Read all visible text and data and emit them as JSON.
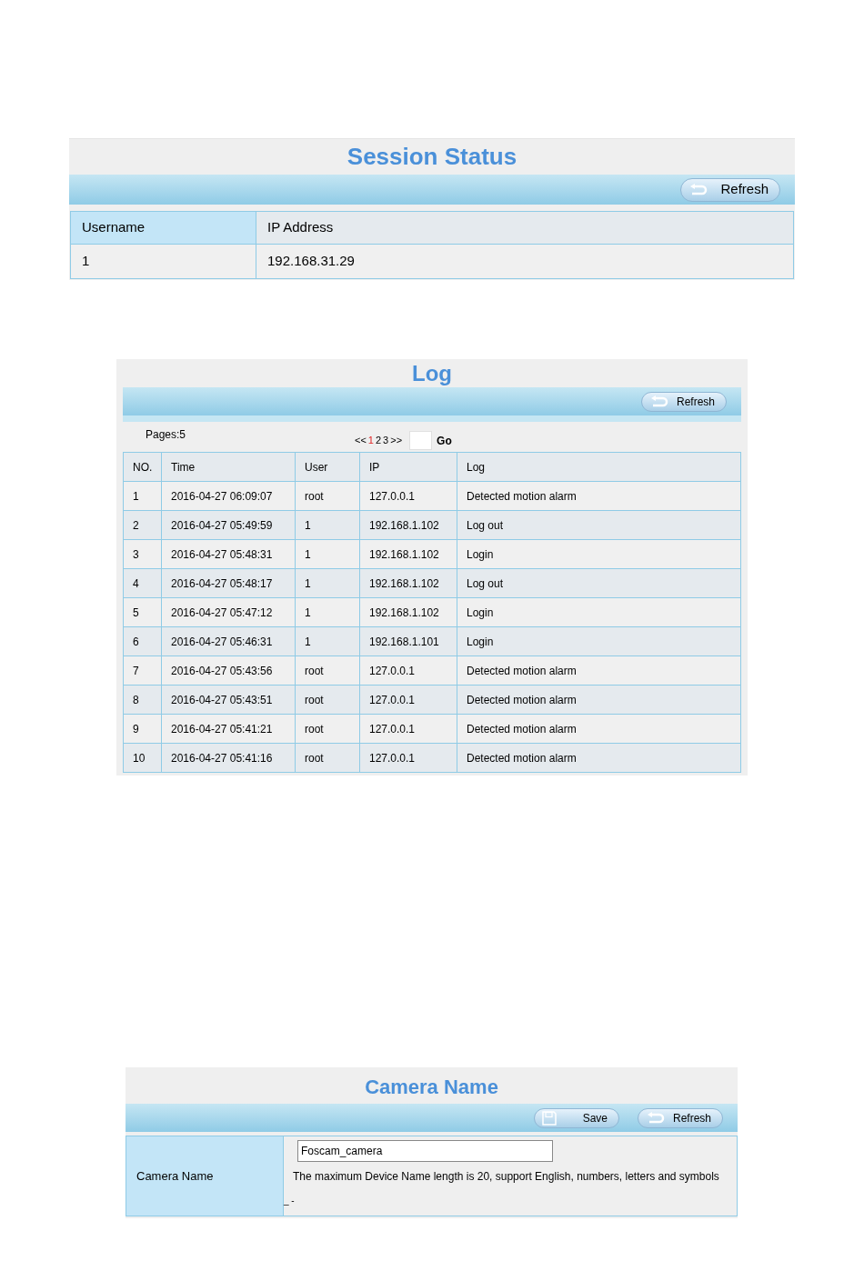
{
  "session_status": {
    "title": "Session Status",
    "buttons": [
      {
        "kind": "refresh",
        "label": "Refresh"
      }
    ],
    "columns": [
      "Username",
      "IP Address"
    ],
    "rows": [
      [
        "1",
        "192.168.31.29"
      ]
    ]
  },
  "log": {
    "title": "Log",
    "buttons": [
      {
        "kind": "refresh",
        "label": "Refresh"
      }
    ],
    "pages_label": "Pages:5",
    "pagination": {
      "prev": "<<",
      "pages": [
        {
          "label": "1",
          "selected": true
        },
        {
          "label": "2",
          "selected": false
        },
        {
          "label": "3",
          "selected": false
        }
      ],
      "next": ">>",
      "go": "Go"
    },
    "columns": [
      "NO.",
      "Time",
      "User",
      "IP",
      "Log"
    ],
    "rows": [
      [
        "1",
        "2016-04-27 06:09:07",
        "root",
        "127.0.0.1",
        "Detected motion alarm"
      ],
      [
        "2",
        "2016-04-27 05:49:59",
        "1",
        "192.168.1.102",
        "Log out"
      ],
      [
        "3",
        "2016-04-27 05:48:31",
        "1",
        "192.168.1.102",
        "Login"
      ],
      [
        "4",
        "2016-04-27 05:48:17",
        "1",
        "192.168.1.102",
        "Log out"
      ],
      [
        "5",
        "2016-04-27 05:47:12",
        "1",
        "192.168.1.102",
        "Login"
      ],
      [
        "6",
        "2016-04-27 05:46:31",
        "1",
        "192.168.1.101",
        "Login"
      ],
      [
        "7",
        "2016-04-27 05:43:56",
        "root",
        "127.0.0.1",
        "Detected motion alarm"
      ],
      [
        "8",
        "2016-04-27 05:43:51",
        "root",
        "127.0.0.1",
        "Detected motion alarm"
      ],
      [
        "9",
        "2016-04-27 05:41:21",
        "root",
        "127.0.0.1",
        "Detected motion alarm"
      ],
      [
        "10",
        "2016-04-27 05:41:16",
        "root",
        "127.0.0.1",
        "Detected motion alarm"
      ]
    ]
  },
  "camera_name": {
    "title": "Camera Name",
    "buttons": [
      {
        "kind": "save",
        "label": "Save"
      },
      {
        "kind": "refresh",
        "label": "Refresh"
      }
    ],
    "field_label": "Camera Name",
    "value": "Foscam_camera",
    "hint": "The maximum Device Name length is 20, support English, numbers, letters and symbols",
    "footer_mark": "_ -"
  }
}
